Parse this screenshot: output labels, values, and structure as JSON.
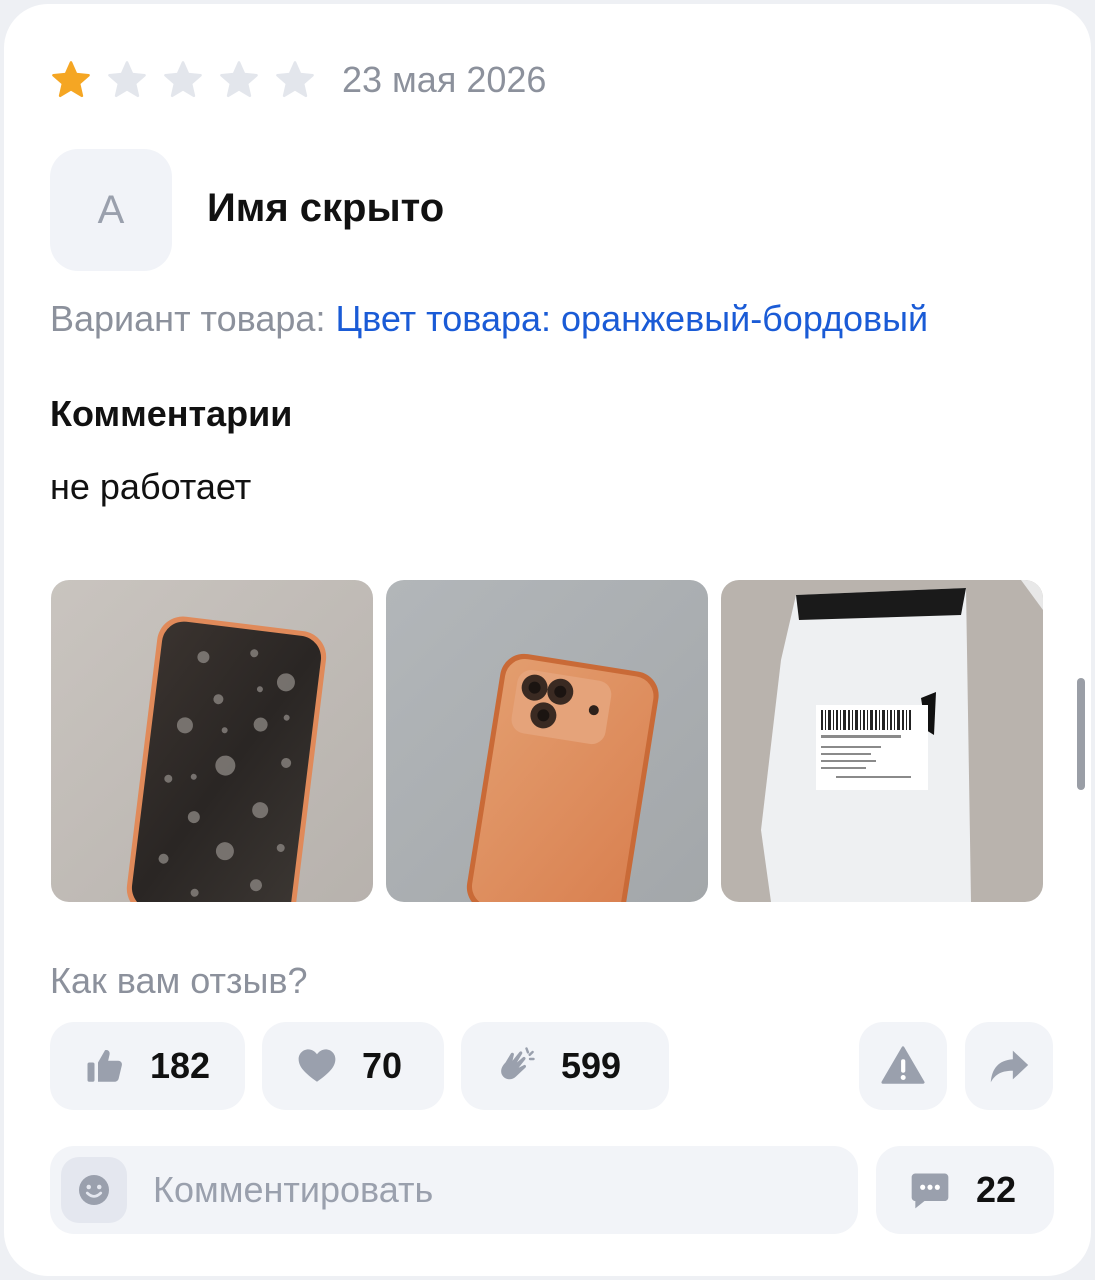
{
  "review": {
    "rating": 1,
    "rating_max": 5,
    "date": "23 мая 2026",
    "author": {
      "avatar_letter": "A",
      "name": "Имя скрыто"
    },
    "variant_label": "Вариант товара:",
    "variant_value": "Цвет товара: оранжевый-бордовый",
    "comments_heading": "Комментарии",
    "comment_text": "не работает",
    "photos": [
      {
        "name": "phone-front-photo"
      },
      {
        "name": "phone-back-photo"
      },
      {
        "name": "package-photo"
      }
    ]
  },
  "feedback": {
    "question": "Как вам отзыв?",
    "reactions": [
      {
        "icon": "thumbs-up-icon",
        "count": "182"
      },
      {
        "icon": "heart-icon",
        "count": "70"
      },
      {
        "icon": "clap-icon",
        "count": "599"
      }
    ],
    "report_icon": "warning-icon",
    "share_icon": "share-icon"
  },
  "comment_input": {
    "placeholder": "Комментировать",
    "emoji_icon": "smiley-icon"
  },
  "comments_count": {
    "icon": "chat-bubble-icon",
    "count": "22"
  },
  "colors": {
    "star_active": "#f5a623",
    "star_inactive": "#e3e6ec",
    "link": "#1a5bd6",
    "muted_text": "#8c919c",
    "icon_gray": "#9aa0ad",
    "button_bg": "#f2f4f8"
  }
}
